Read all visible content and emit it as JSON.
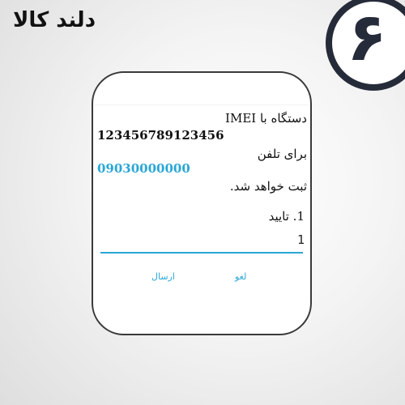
{
  "brand": {
    "name": "دلند کالا"
  },
  "step": {
    "number": "۶"
  },
  "dialog": {
    "line1": "دستگاه با IMEI",
    "imei": "123456789123456",
    "line3": "برای تلفن",
    "phone": "09030000000",
    "line5": "ثبت خواهد شد.",
    "option1": "1. تایید",
    "input_value": "1",
    "cancel_label": "لغو",
    "send_label": "ارسال"
  },
  "colors": {
    "accent": "#2aa7d6",
    "badge": "#262b3a"
  }
}
